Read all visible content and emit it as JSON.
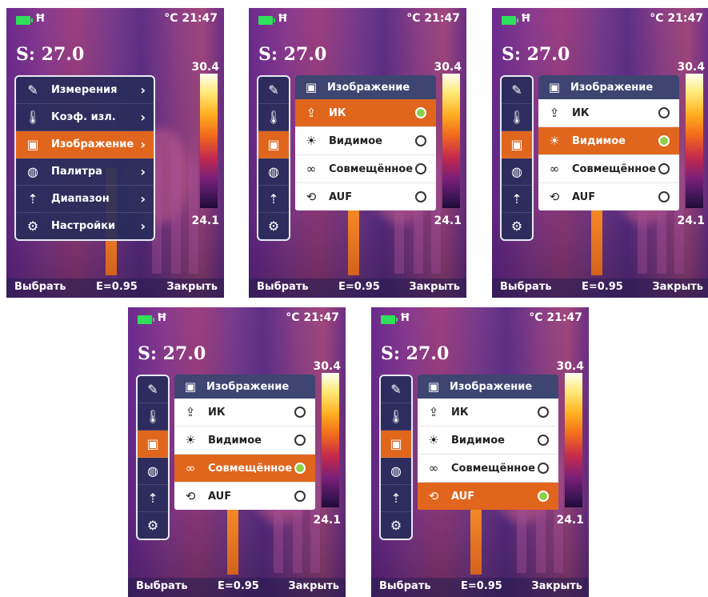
{
  "status": {
    "sd_label": "Ħ",
    "clock": "°C 21:47"
  },
  "spot_temp": "S: 27.0",
  "scale": {
    "max": "30.4",
    "min": "24.1"
  },
  "bottom": {
    "left_button": "Выбрать",
    "emissivity": "E=0.95",
    "right_button": "Закрыть"
  },
  "menu": {
    "items": [
      {
        "label": "Измерения",
        "icon": "measure-icon",
        "chevron": "›"
      },
      {
        "label": "Коэф. изл.",
        "icon": "thermometer-icon",
        "chevron": "›"
      },
      {
        "label": "Изображение",
        "icon": "image-icon",
        "chevron": "›"
      },
      {
        "label": "Палитра",
        "icon": "palette-icon",
        "chevron": "›"
      },
      {
        "label": "Диапазон",
        "icon": "range-icon",
        "chevron": "›"
      },
      {
        "label": "Настройки",
        "icon": "gear-icon",
        "chevron": "›"
      }
    ]
  },
  "submenu": {
    "title": "Изображение",
    "items": [
      {
        "label": "ИК",
        "icon": "ir-icon"
      },
      {
        "label": "Видимое",
        "icon": "sun-icon"
      },
      {
        "label": "Совмещённое",
        "icon": "blend-icon"
      },
      {
        "label": "AUF",
        "icon": "auf-icon"
      }
    ]
  },
  "colors": {
    "accent": "#e0661d",
    "menu_bg": "#2d325a",
    "radio_on": "#8ed04a"
  }
}
